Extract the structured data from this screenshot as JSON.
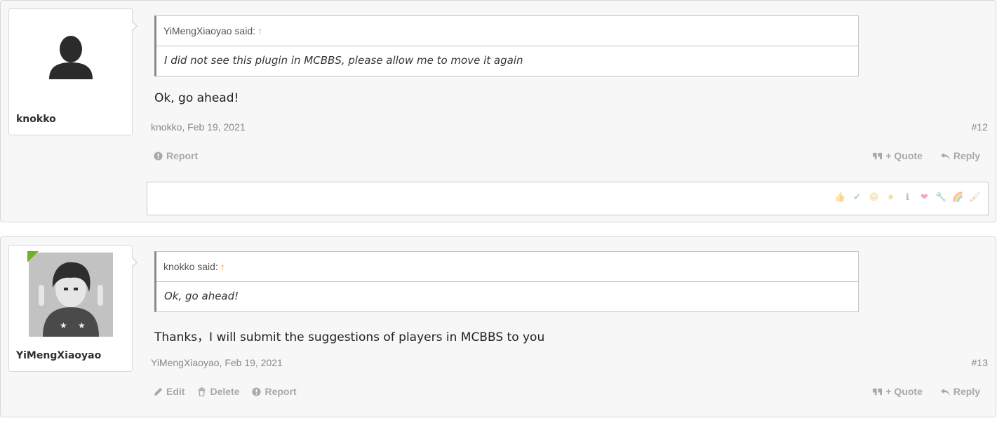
{
  "posts": [
    {
      "username": "knokko",
      "avatar_type": "default-avatar-icon",
      "quote": {
        "author_said": "YiMengXiaoyao said:",
        "arrow": "↑",
        "text": "I did not see this plugin in MCBBS, please allow me to move it again"
      },
      "message": "Ok, go ahead!",
      "meta": "knokko, Feb 19, 2021",
      "post_number": "#12",
      "actions_left": [
        "Report"
      ],
      "actions_right": [
        "+ Quote",
        "Reply"
      ],
      "reactions": [
        "thumbs-up-icon",
        "check-icon",
        "laugh-icon",
        "star-icon",
        "info-icon",
        "heart-icon",
        "wrench-icon",
        "rainbow-icon",
        "brush-icon"
      ]
    },
    {
      "username": "YiMengXiaoyao",
      "avatar_type": "user-photo",
      "quote": {
        "author_said": "knokko said:",
        "arrow": "↑",
        "text": "Ok, go ahead!"
      },
      "message": "Thanks，I will submit the suggestions of players in MCBBS to you",
      "meta": "YiMengXiaoyao, Feb 19, 2021",
      "post_number": "#13",
      "actions_left": [
        "Edit",
        "Delete",
        "Report"
      ],
      "actions_right": [
        "+ Quote",
        "Reply"
      ]
    }
  ],
  "colors": {
    "post_bg": "#f7f7f7",
    "border": "#d8d8d8",
    "action_text": "#a8a8a8",
    "arrow_accent": "#f0a030",
    "staff_badge": "#6fb22a"
  }
}
